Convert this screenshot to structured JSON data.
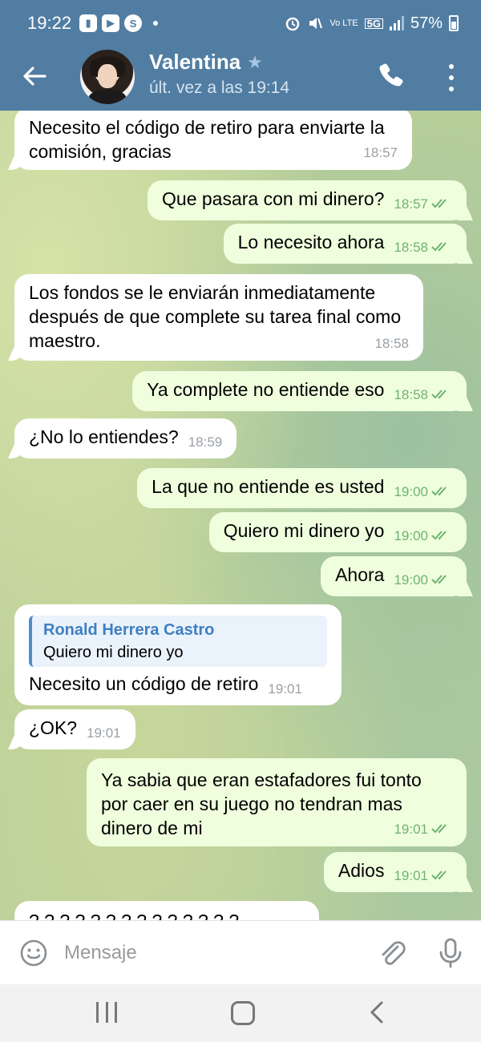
{
  "status_bar": {
    "time": "19:22",
    "battery": "57%",
    "network": "5G",
    "volte": "Vo LTE"
  },
  "header": {
    "contact_name": "Valentina",
    "last_seen": "últ. vez a las 19:14"
  },
  "messages": [
    {
      "dir": "in",
      "text": "Necesito el código de retiro para enviarte la comisión, gracias",
      "time": "18:57"
    },
    {
      "dir": "out",
      "text": "Que pasara con mi dinero?",
      "time": "18:57"
    },
    {
      "dir": "out",
      "text": "Lo necesito ahora",
      "time": "18:58"
    },
    {
      "dir": "in",
      "text": "Los fondos se le enviarán inmediatamente después de que complete su tarea final como maestro.",
      "time": "18:58"
    },
    {
      "dir": "out",
      "text": "Ya complete no entiende eso",
      "time": "18:58"
    },
    {
      "dir": "in",
      "text": "¿No lo entiendes?",
      "time": "18:59"
    },
    {
      "dir": "out",
      "text": "La que no entiende es usted",
      "time": "19:00"
    },
    {
      "dir": "out",
      "text": "Quiero mi dinero yo",
      "time": "19:00"
    },
    {
      "dir": "out",
      "text": "Ahora",
      "time": "19:00"
    },
    {
      "dir": "in",
      "reply_to_name": "Ronald Herrera Castro",
      "reply_to_text": "Quiero mi dinero yo",
      "text": "Necesito un código de retiro",
      "time": "19:01"
    },
    {
      "dir": "in",
      "text": "¿OK?",
      "time": "19:01"
    },
    {
      "dir": "out",
      "text": "Ya sabia que eran estafadores fui tonto por caer en su juego no tendran mas dinero de mi",
      "time": "19:01"
    },
    {
      "dir": "out",
      "text": "Adios",
      "time": "19:01"
    },
    {
      "dir": "in",
      "text": "? ? ? ? ? ? ? ? ? ? ? ? ? ?",
      "time": ""
    }
  ],
  "input": {
    "placeholder": "Mensaje"
  },
  "colors": {
    "header": "#517da2",
    "incoming_bubble": "#ffffff",
    "outgoing_bubble": "#efffde",
    "read_ticks": "#6fb26f",
    "reply_accent": "#4f8ccb"
  },
  "icons": {
    "back": "arrow-left-icon",
    "call": "phone-icon",
    "menu": "more-vertical-icon",
    "emoji": "emoji-icon",
    "attach": "paperclip-icon",
    "mic": "microphone-icon"
  }
}
